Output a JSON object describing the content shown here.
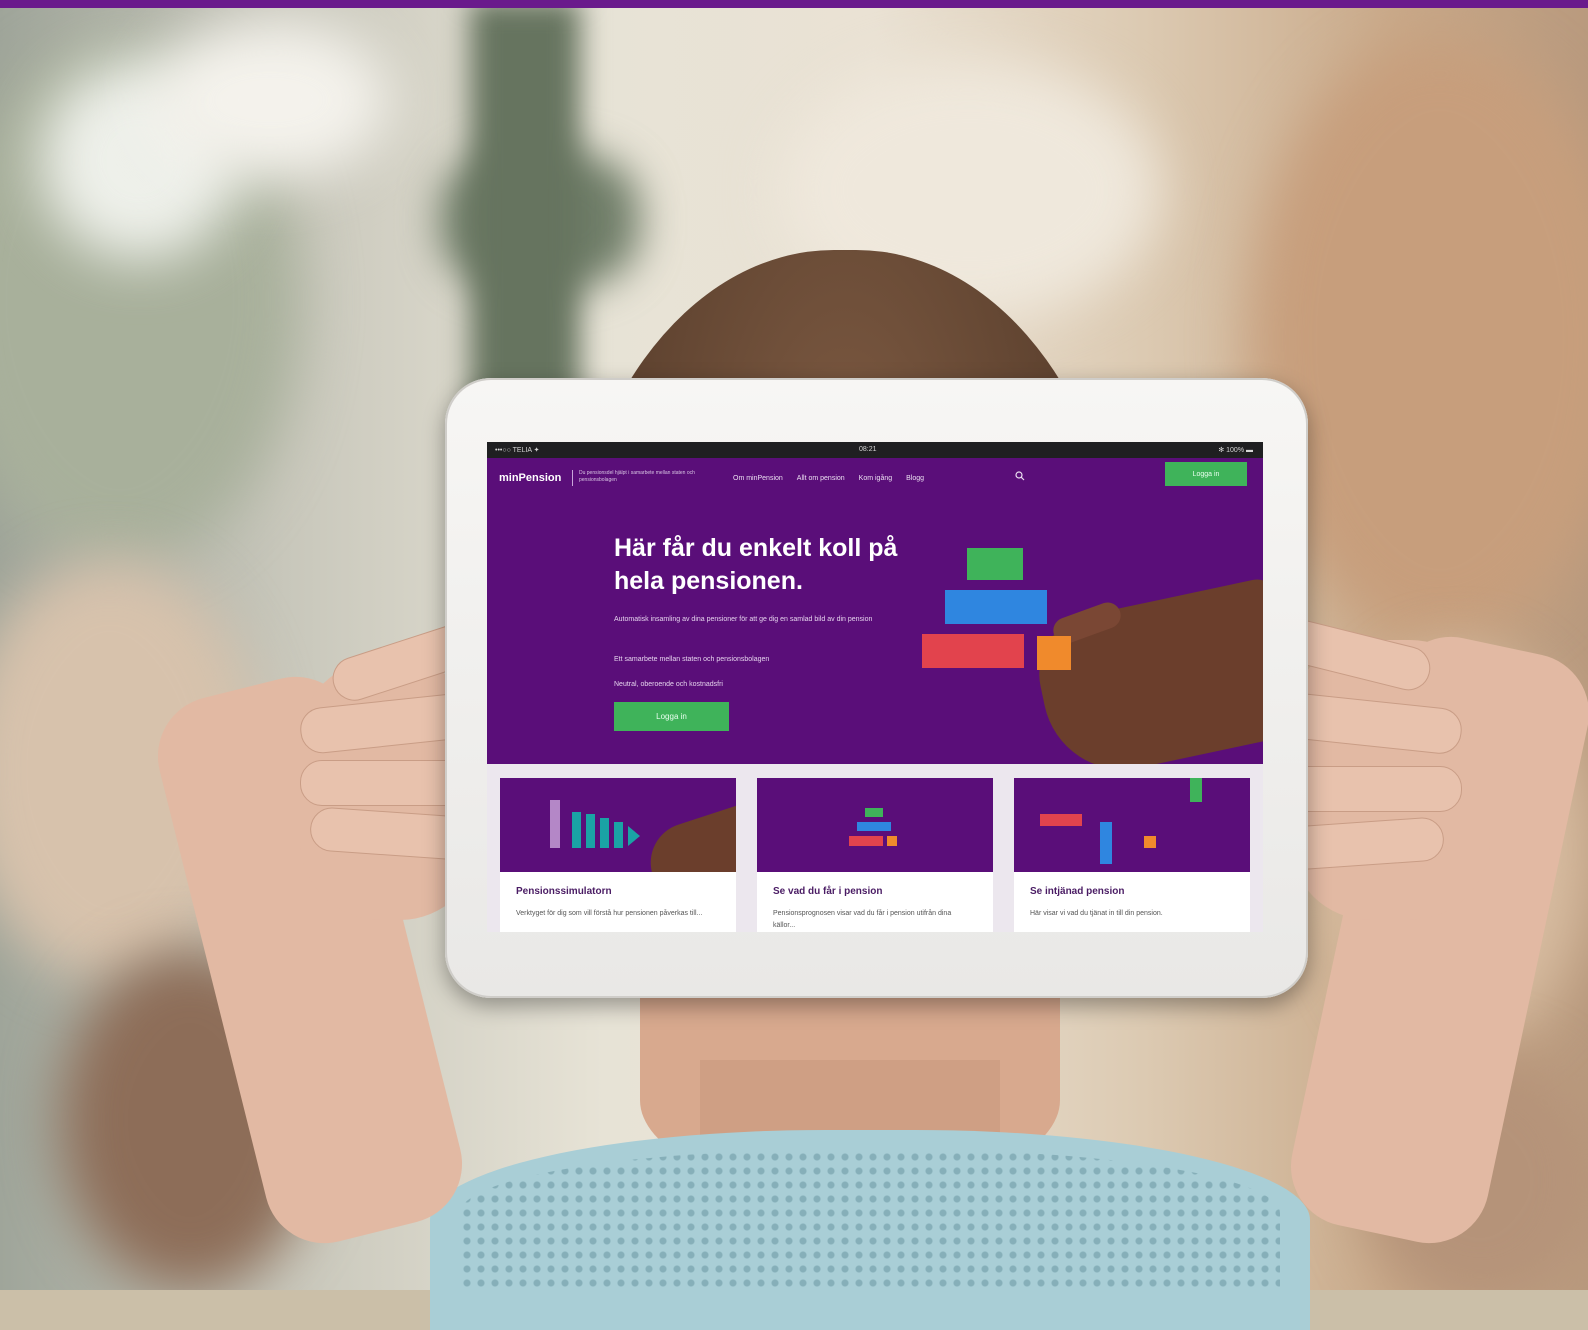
{
  "colors": {
    "brand_purple": "#5a0e79",
    "top_bar": "#6a1a8c",
    "button_green": "#3fb35a",
    "block_green": "#3fb35a",
    "block_blue": "#2f86e0",
    "block_red": "#e2434d",
    "block_orange": "#f08a2c",
    "block_teal": "#1aa3a5",
    "block_lilac": "#b487c7"
  },
  "status_bar": {
    "left": "•••○○ TELIA ✦",
    "center": "08:21",
    "right": "✻ 100% ▬"
  },
  "site": {
    "logo": "minPension",
    "tagline": "Du pensionsdel hjälpt i samarbete mellan staten och pensionsbolagen",
    "nav": [
      "Om minPension",
      "Allt om pension",
      "Kom igång",
      "Blogg"
    ],
    "search_icon": "search-icon",
    "login_top": "Logga in"
  },
  "hero": {
    "title": "Här får du enkelt koll på hela pensionen.",
    "p1": "Automatisk insamling av dina pensioner för att ge dig en samlad bild av din pension",
    "p2": "Ett samarbete mellan staten och pensionsbolagen",
    "p3": "Neutral, oberoende och kostnadsfri",
    "login": "Logga in"
  },
  "cards": [
    {
      "title": "Pensionssimulatorn",
      "text": "Verktyget för dig som vill förstå hur pensionen påverkas till..."
    },
    {
      "title": "Se vad du får i pension",
      "text": "Pensionsprognosen visar vad du får i pension utifrån dina källor..."
    },
    {
      "title": "Se intjänad pension",
      "text": "Här visar vi vad du tjänat in till din pension."
    }
  ]
}
